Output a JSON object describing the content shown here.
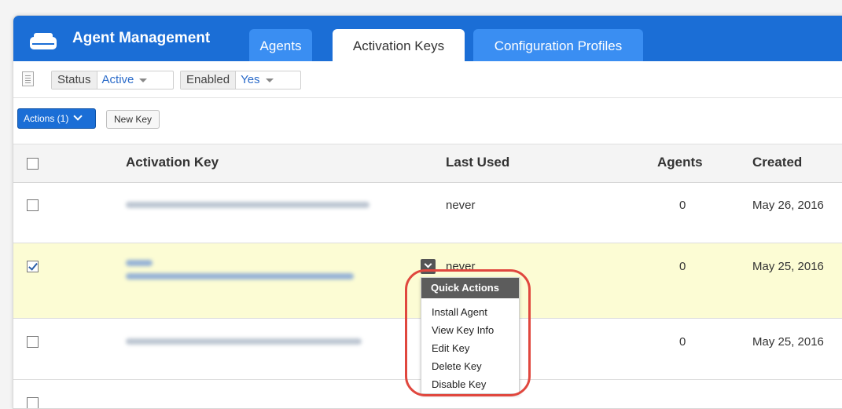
{
  "app": {
    "title": "Agent Management"
  },
  "tabs": [
    {
      "label": "Agents",
      "active": false
    },
    {
      "label": "Activation Keys",
      "active": true
    },
    {
      "label": "Configuration Profiles",
      "active": false
    }
  ],
  "filters": {
    "status": {
      "label": "Status",
      "value": "Active"
    },
    "enabled": {
      "label": "Enabled",
      "value": "Yes"
    }
  },
  "toolbar": {
    "actions_label": "Actions (1)",
    "new_key_label": "New Key"
  },
  "table": {
    "columns": [
      "Activation Key",
      "Last Used",
      "Agents",
      "Created"
    ],
    "rows": [
      {
        "last_used": "never",
        "agents": "0",
        "created": "May 26, 2016",
        "selected": false
      },
      {
        "last_used": "never",
        "agents": "0",
        "created": "May 25, 2016",
        "selected": true
      },
      {
        "last_used": "",
        "agents": "0",
        "created": "May 25, 2016",
        "selected": false
      }
    ]
  },
  "quick_actions": {
    "title": "Quick Actions",
    "items": [
      "Install Agent",
      "View Key Info",
      "Edit Key",
      "Delete Key",
      "Disable Key"
    ]
  },
  "colors": {
    "header_blue": "#1b6ed6",
    "tab_inactive": "#3a8ef2",
    "selected_row": "#fcfcd4",
    "highlight_ring": "#e0473e"
  }
}
